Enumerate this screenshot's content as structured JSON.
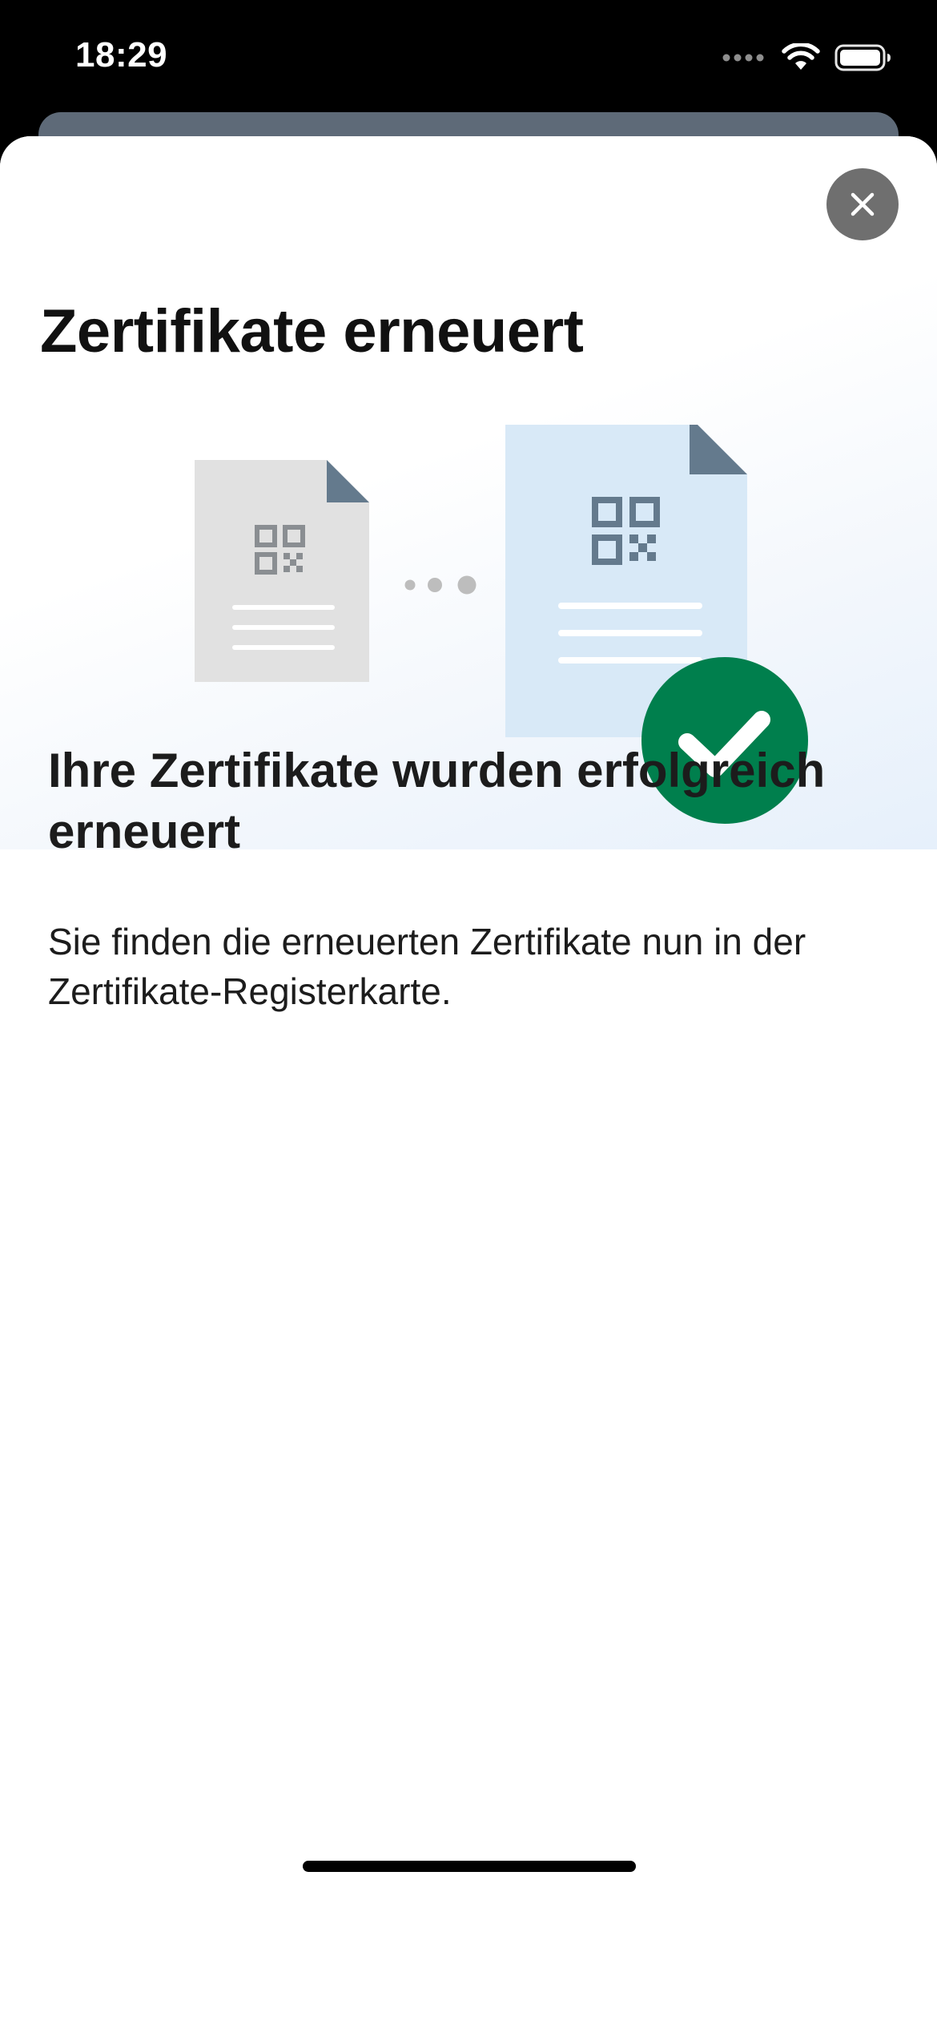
{
  "status_bar": {
    "time": "18:29",
    "icons": [
      "signal-dots-icon",
      "wifi-icon",
      "battery-icon"
    ]
  },
  "sheet": {
    "close_icon": "close-icon",
    "title": "Zertifikate erneuert",
    "subtitle": "Ihre Zertifikate wurden erfolgreich erneuert",
    "body": "Sie finden die erneuerten Zertifikate nun in der Zertifikate-Registerkarte."
  },
  "illustration": {
    "old_certificate_icon": "certificate-document-icon",
    "new_certificate_icon": "certificate-document-icon",
    "progress_icon": "dots-icon",
    "success_icon": "checkmark-icon"
  },
  "colors": {
    "success_green": "#007f4d",
    "close_button_gray": "#6f6f6f",
    "document_old_gray": "#e1e1e1",
    "document_new_blue": "#d8e9f7",
    "document_fold": "#647a8d",
    "qr_gray": "#8a8e92",
    "qr_slate": "#647a8d"
  }
}
